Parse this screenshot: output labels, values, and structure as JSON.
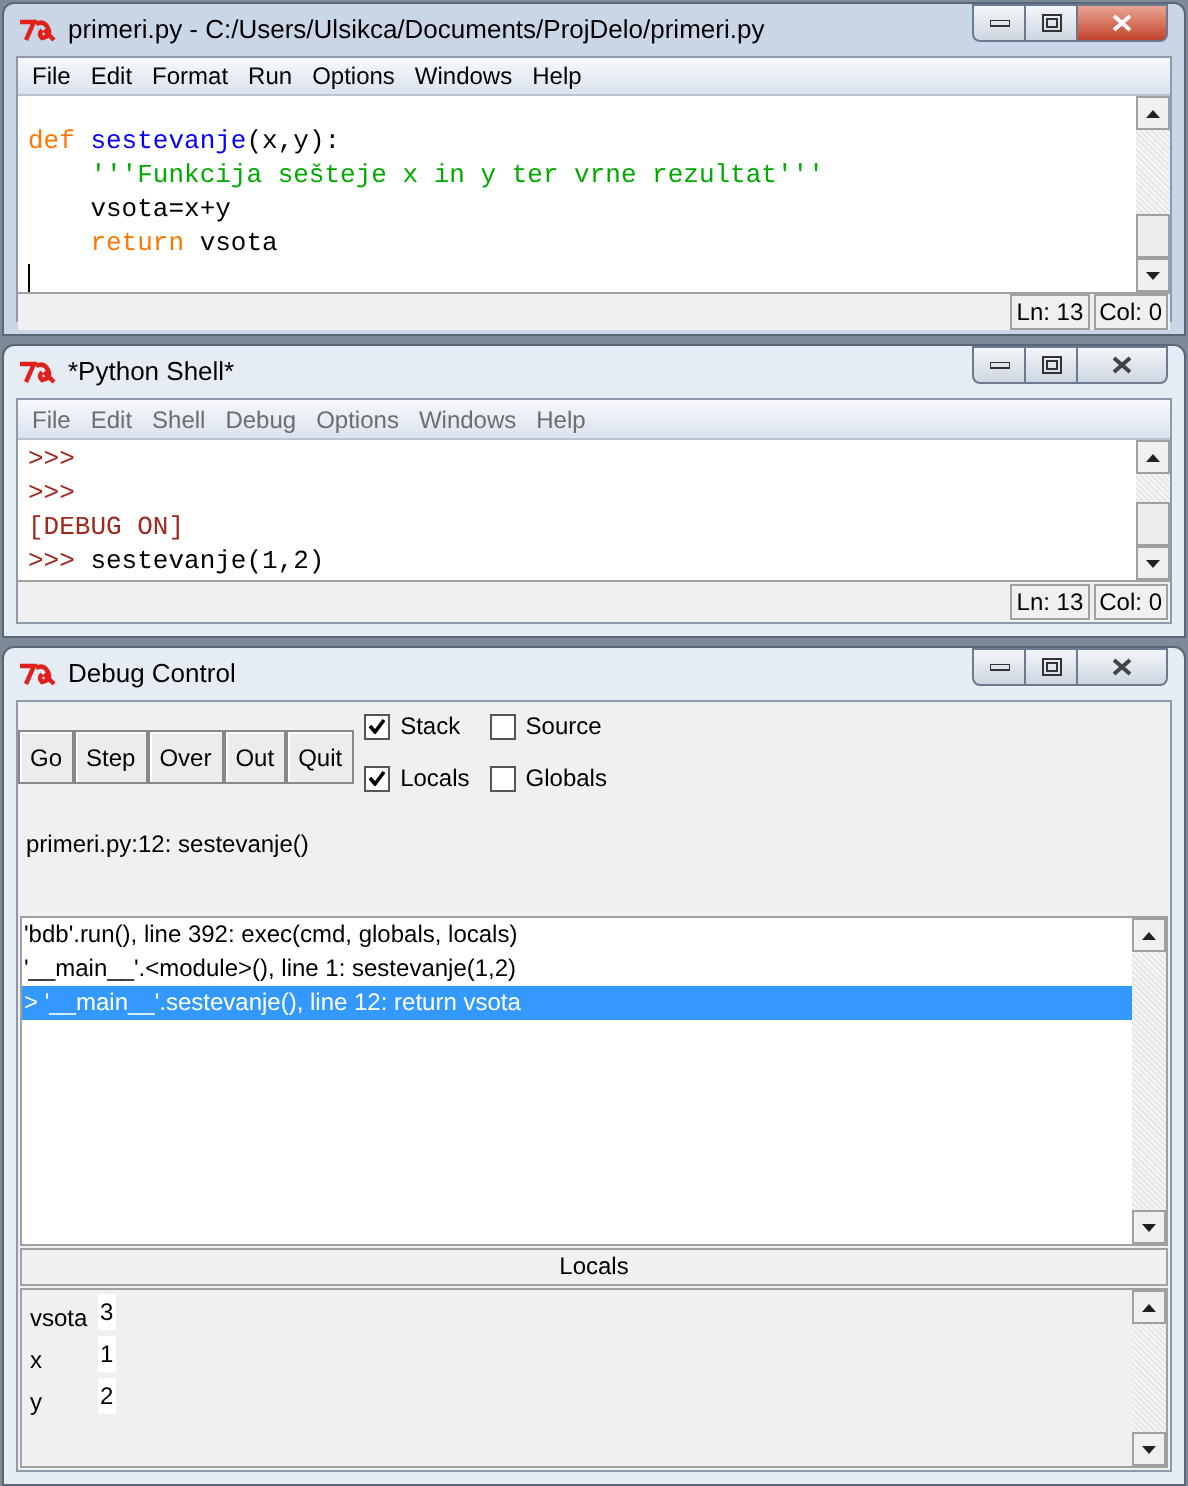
{
  "editor": {
    "title": "primeri.py - C:/Users/Ulsikca/Documents/ProjDelo/primeri.py",
    "active": true,
    "menu": [
      "File",
      "Edit",
      "Format",
      "Run",
      "Options",
      "Windows",
      "Help"
    ],
    "lines": [
      [
        {
          "text": "def",
          "kind": "keyword"
        },
        {
          "text": " sestevanje",
          "kind": "definition"
        },
        {
          "text": "(x,y):",
          "kind": "plain"
        }
      ],
      [
        {
          "text": "    '''Funkcija sešteje x in y ter vrne rezultat'''",
          "kind": "string"
        }
      ],
      [
        {
          "text": "    vsota=x+y",
          "kind": "plain"
        }
      ],
      [
        {
          "text": "    return",
          "kind": "keyword"
        },
        {
          "text": " vsota",
          "kind": "plain"
        }
      ]
    ],
    "ln": "Ln: 13",
    "col": "Col: 0"
  },
  "shell": {
    "title": "*Python Shell*",
    "active": false,
    "menu": [
      "File",
      "Edit",
      "Shell",
      "Debug",
      "Options",
      "Windows",
      "Help"
    ],
    "lines": [
      [
        {
          "text": ">>>",
          "kind": "output"
        }
      ],
      [
        {
          "text": ">>>",
          "kind": "output"
        }
      ],
      [
        {
          "text": "[DEBUG ON]",
          "kind": "output"
        }
      ],
      [
        {
          "text": ">>>",
          "kind": "output"
        },
        {
          "text": " sestevanje(1,2)",
          "kind": "plain"
        }
      ]
    ],
    "ln": "Ln: 13",
    "col": "Col: 0"
  },
  "debug": {
    "title": "Debug Control",
    "active": false,
    "buttons": [
      "Go",
      "Step",
      "Over",
      "Out",
      "Quit"
    ],
    "checkboxes": [
      {
        "label": "Stack",
        "checked": true
      },
      {
        "label": "Source",
        "checked": false
      },
      {
        "label": "Locals",
        "checked": true
      },
      {
        "label": "Globals",
        "checked": false
      }
    ],
    "status": "primeri.py:12: sestevanje()",
    "stack": [
      {
        "text": "'bdb'.run(), line 392: exec(cmd, globals, locals)",
        "selected": false
      },
      {
        "text": "'__main__'.<module>(), line 1: sestevanje(1,2)",
        "selected": false
      },
      {
        "text": "> '__main__'.sestevanje(), line 12: return vsota",
        "selected": true
      }
    ],
    "locals_header": "Locals",
    "locals": [
      {
        "name": "vsota",
        "value": "3"
      },
      {
        "name": "x",
        "value": "1"
      },
      {
        "name": "y",
        "value": "2"
      }
    ]
  }
}
